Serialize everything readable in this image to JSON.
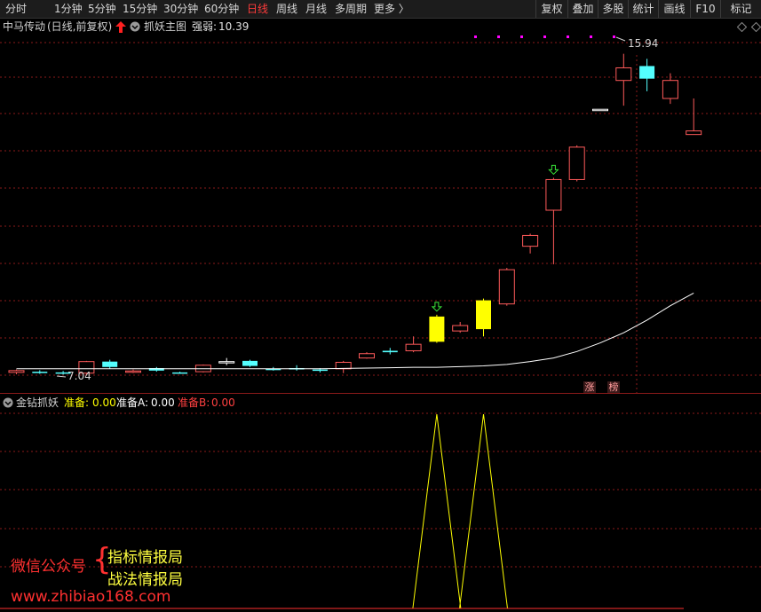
{
  "toolbar": {
    "periods": [
      "分时",
      "1分钟",
      "5分钟",
      "15分钟",
      "30分钟",
      "60分钟",
      "日线",
      "周线",
      "月线",
      "多周期",
      "更多 〉"
    ],
    "active_period": "日线",
    "buttons": [
      "复权",
      "叠加",
      "多股",
      "统计",
      "画线",
      "F10",
      "标记"
    ]
  },
  "main_chart": {
    "stock_name": "中马传动",
    "adjust_mode": "(日线,前复权)",
    "indicator_name": "抓妖主图",
    "strength_label": "强弱:",
    "strength_value": "10.39",
    "high_label": "15.94",
    "low_label": "7.04",
    "badges": [
      "涨",
      "榜"
    ]
  },
  "sub_chart": {
    "indicator_name": "金钻抓妖",
    "prep_label": "准备:",
    "prep_value": "0.00",
    "prep_a_label": "准备A:",
    "prep_a_value": "0.00",
    "prep_b_label": "准备B:",
    "prep_b_value": "0.00"
  },
  "watermark": {
    "line_left": "微信公众号",
    "line_right_1": "指标情报局",
    "line_right_2": "战法情报局",
    "url": "www.zhibiao168.com"
  },
  "colors": {
    "up": "#ff5a5a",
    "down": "#54ffff",
    "signal": "#ffff00",
    "ma": "#ffffff",
    "grid": "#8b1a1a",
    "arrow": "#39e639",
    "marker": "#ff00ff"
  },
  "chart_data": {
    "type": "candlestick",
    "candles": [
      {
        "o": 7.1,
        "c": 7.15,
        "h": 7.18,
        "l": 7.05,
        "dir": "up"
      },
      {
        "o": 7.12,
        "c": 7.1,
        "h": 7.16,
        "l": 7.06,
        "dir": "down"
      },
      {
        "o": 7.1,
        "c": 7.08,
        "h": 7.14,
        "l": 7.04,
        "dir": "down"
      },
      {
        "o": 7.08,
        "c": 7.4,
        "h": 7.42,
        "l": 7.02,
        "dir": "up"
      },
      {
        "o": 7.4,
        "c": 7.25,
        "h": 7.45,
        "l": 7.2,
        "dir": "down"
      },
      {
        "o": 7.12,
        "c": 7.14,
        "h": 7.18,
        "l": 7.08,
        "dir": "up"
      },
      {
        "o": 7.22,
        "c": 7.15,
        "h": 7.25,
        "l": 7.12,
        "dir": "down"
      },
      {
        "o": 7.08,
        "c": 7.1,
        "h": 7.12,
        "l": 7.06,
        "dir": "down"
      },
      {
        "o": 7.12,
        "c": 7.3,
        "h": 7.32,
        "l": 7.1,
        "dir": "up"
      },
      {
        "o": 7.4,
        "c": 7.4,
        "h": 7.5,
        "l": 7.3,
        "dir": "flat"
      },
      {
        "o": 7.42,
        "c": 7.28,
        "h": 7.45,
        "l": 7.25,
        "dir": "down"
      },
      {
        "o": 7.18,
        "c": 7.2,
        "h": 7.25,
        "l": 7.15,
        "dir": "down"
      },
      {
        "o": 7.2,
        "c": 7.22,
        "h": 7.3,
        "l": 7.15,
        "dir": "down"
      },
      {
        "o": 7.15,
        "c": 7.18,
        "h": 7.22,
        "l": 7.1,
        "dir": "down"
      },
      {
        "o": 7.2,
        "c": 7.38,
        "h": 7.42,
        "l": 7.08,
        "dir": "up"
      },
      {
        "o": 7.5,
        "c": 7.62,
        "h": 7.66,
        "l": 7.48,
        "dir": "up"
      },
      {
        "o": 7.66,
        "c": 7.7,
        "h": 7.78,
        "l": 7.6,
        "dir": "down"
      },
      {
        "o": 7.7,
        "c": 7.88,
        "h": 8.1,
        "l": 7.66,
        "dir": "up"
      },
      {
        "o": 7.95,
        "c": 8.65,
        "h": 8.7,
        "l": 7.92,
        "dir": "signal"
      },
      {
        "o": 8.25,
        "c": 8.4,
        "h": 8.5,
        "l": 8.2,
        "dir": "up"
      },
      {
        "o": 8.3,
        "c": 9.1,
        "h": 9.15,
        "l": 8.1,
        "dir": "signal"
      },
      {
        "o": 9.0,
        "c": 9.95,
        "h": 10.0,
        "l": 8.95,
        "dir": "up"
      },
      {
        "o": 10.6,
        "c": 10.9,
        "h": 10.95,
        "l": 10.4,
        "dir": "up"
      },
      {
        "o": 11.6,
        "c": 12.45,
        "h": 12.5,
        "l": 10.1,
        "dir": "up"
      },
      {
        "o": 12.45,
        "c": 13.35,
        "h": 13.4,
        "l": 12.4,
        "dir": "up"
      },
      {
        "o": 14.4,
        "c": 14.4,
        "h": 14.4,
        "l": 14.4,
        "dir": "flat"
      },
      {
        "o": 15.2,
        "c": 15.55,
        "h": 15.94,
        "l": 14.5,
        "dir": "up"
      },
      {
        "o": 15.6,
        "c": 15.25,
        "h": 15.8,
        "l": 14.9,
        "dir": "down"
      },
      {
        "o": 14.7,
        "c": 15.2,
        "h": 15.4,
        "l": 14.55,
        "dir": "up"
      },
      {
        "o": 13.7,
        "c": 13.8,
        "h": 14.7,
        "l": 13.7,
        "dir": "up"
      }
    ],
    "ma": [
      7.2,
      7.2,
      7.2,
      7.2,
      7.2,
      7.2,
      7.2,
      7.2,
      7.2,
      7.2,
      7.2,
      7.2,
      7.2,
      7.2,
      7.21,
      7.22,
      7.23,
      7.24,
      7.24,
      7.26,
      7.28,
      7.32,
      7.4,
      7.5,
      7.68,
      7.92,
      8.2,
      8.55,
      8.95,
      9.3
    ],
    "signal_arrows": [
      18,
      23
    ],
    "sub_signal": [
      0,
      0,
      0,
      0,
      0,
      0,
      0,
      0,
      0,
      0,
      0,
      0,
      0,
      0,
      0,
      0,
      0,
      0,
      1,
      0,
      1,
      0,
      0,
      0,
      0,
      0,
      0,
      0,
      0,
      0
    ]
  }
}
